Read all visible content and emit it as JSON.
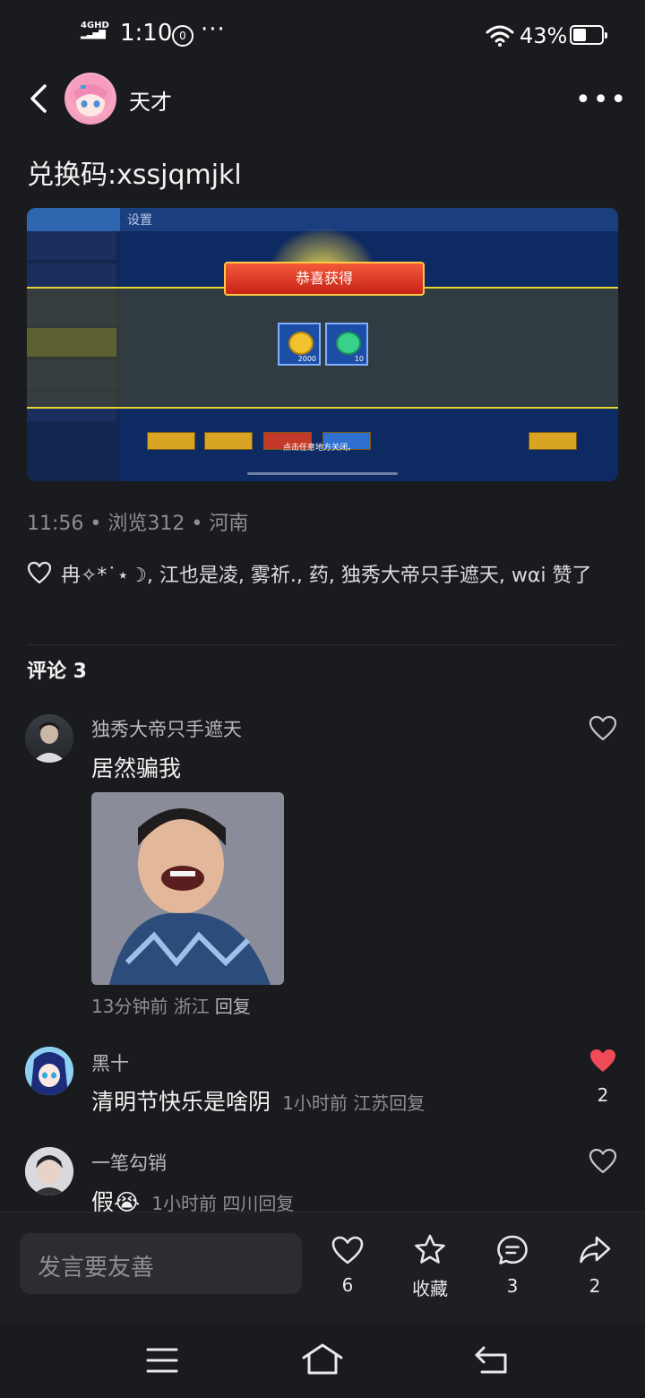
{
  "status_bar": {
    "network": "4GHD",
    "time": "1:10",
    "vpn_glyph": "⓪",
    "more": "···",
    "battery_percent": "43%",
    "battery_level": 0.43
  },
  "header": {
    "username": "天才",
    "more_icon": "more-horizontal-icon"
  },
  "post": {
    "text": "兑换码:xssjqmjkl",
    "image": {
      "title": "设置",
      "banner": "恭喜获得",
      "items": [
        {
          "icon": "gold-coin-icon",
          "quantity": "2000"
        },
        {
          "icon": "green-gem-icon",
          "quantity": "10"
        }
      ],
      "close_hint": "点击任意地方关闭。"
    },
    "meta": "11:56 • 浏览312 • 河南",
    "likes_text": "冉✧*˙⋆☽, 江也是凌, 雾祈., 药, 独秀大帝只手遮天, wαi 赞了"
  },
  "comments": {
    "title": "评论 3",
    "items": [
      {
        "name": "独秀大帝只手遮天",
        "text": "居然骗我",
        "meta": "13分钟前 浙江",
        "reply": "回复",
        "liked": false,
        "like_count": ""
      },
      {
        "name": "黑十",
        "text": "清明节快乐是啥阴",
        "meta": "1小时前 江苏",
        "reply": "回复",
        "liked": true,
        "like_count": "2"
      },
      {
        "name": "一笔勾销",
        "text": "假😭",
        "meta": "1小时前 四川",
        "reply": "回复",
        "liked": false,
        "like_count": ""
      }
    ]
  },
  "action_bar": {
    "input_placeholder": "发言要友善",
    "like_count": "6",
    "favorite_label": "收藏",
    "comment_count": "3",
    "share_count": "2"
  },
  "colors": {
    "background": "#1a1b1e",
    "like_red": "#ef4a55",
    "muted_text": "#8e8f94"
  }
}
